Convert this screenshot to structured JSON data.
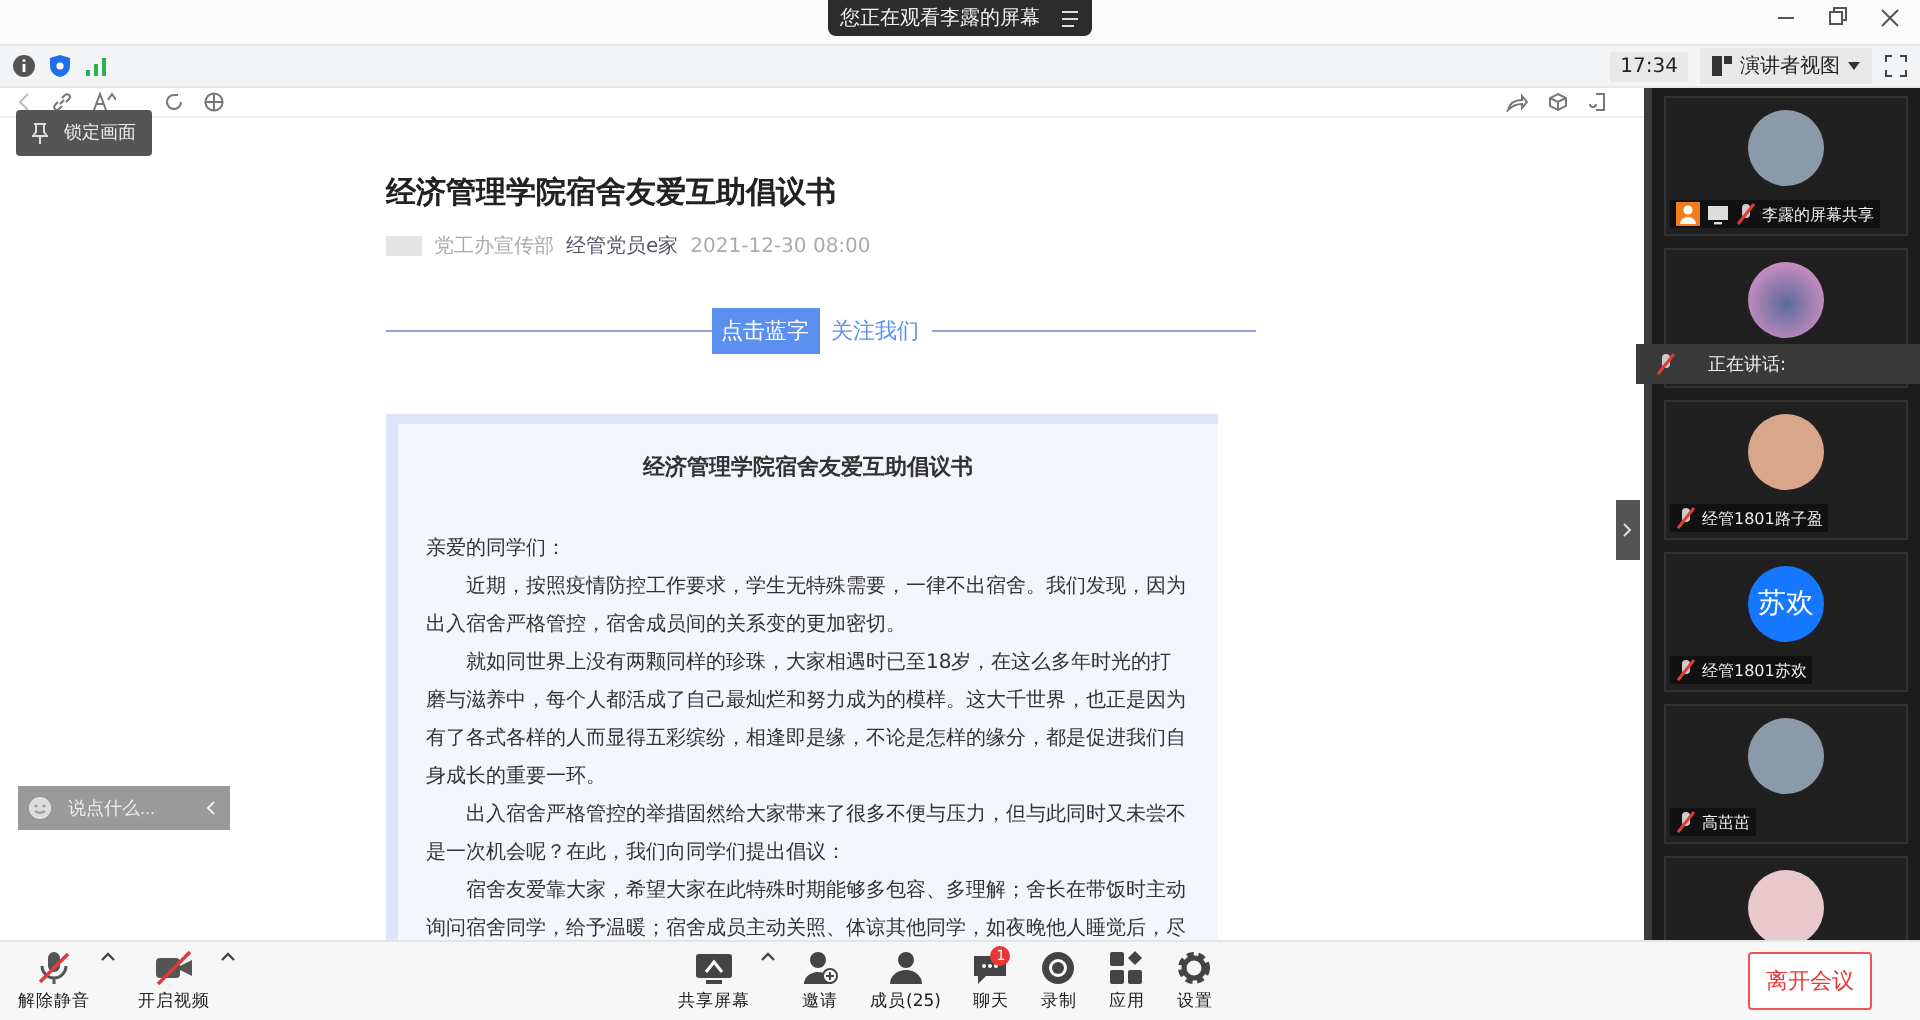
{
  "banner": {
    "text": "您正在观看李露的屏幕"
  },
  "status_bar": {
    "time": "17:34",
    "view_mode": "演讲者视图"
  },
  "pin_tooltip": {
    "label": "锁定画面"
  },
  "article": {
    "title": "经济管理学院宿舍友爱互助倡议书",
    "author": "党工办宣传部",
    "account": "经管党员e家",
    "date": "2021-12-30 08:00",
    "follow_button": "点击蓝字",
    "follow_text": "关注我们",
    "card_title": "经济管理学院宿舍友爱互助倡议书",
    "salutation": "亲爱的同学们：",
    "paragraphs": [
      "近期，按照疫情防控工作要求，学生无特殊需要，一律不出宿舍。我们发现，因为出入宿舍严格管控，宿舍成员间的关系变的更加密切。",
      "就如同世界上没有两颗同样的珍珠，大家相遇时已至18岁，在这么多年时光的打磨与滋养中，每个人都活成了自己最灿烂和努力成为的模样。这大千世界，也正是因为有了各式各样的人而显得五彩缤纷，相逢即是缘，不论是怎样的缘分，都是促进我们自身成长的重要一环。",
      "出入宿舍严格管控的举措固然给大家带来了很多不便与压力，但与此同时又未尝不是一次机会呢？在此，我们向同学们提出倡议：",
      "宿舍友爱靠大家，希望大家在此特殊时期能够多包容、多理解；舍长在带饭时主动询问宿舍同学，给予温暖；宿舍成员主动关照、体谅其他同学，如夜晚他人睡觉后，尽"
    ]
  },
  "chat_input": {
    "placeholder": "说点什么..."
  },
  "speaking": {
    "label": "正在讲话:"
  },
  "participants": [
    {
      "name": "李露的屏幕共享",
      "kind": "photo",
      "host": true,
      "sharing": true
    },
    {
      "kind": "cartoon"
    },
    {
      "name": "经管1801路子盈",
      "kind": "photo",
      "host": false,
      "sharing": false
    },
    {
      "name": "经管1801苏欢",
      "kind": "initials",
      "initials": "苏欢",
      "host": false,
      "sharing": false
    },
    {
      "name": "高茁茁",
      "kind": "photo",
      "host": false,
      "sharing": false
    },
    {
      "kind": "photo"
    }
  ],
  "toolbar": {
    "left": [
      {
        "label": "解除静音",
        "kind": "mic"
      },
      {
        "label": "开启视频",
        "kind": "video"
      }
    ],
    "center": [
      {
        "label": "共享屏幕",
        "kind": "share"
      },
      {
        "label": "邀请",
        "kind": "invite"
      },
      {
        "label": "成员(25)",
        "kind": "members"
      },
      {
        "label": "聊天",
        "kind": "chat",
        "badge": "1"
      },
      {
        "label": "录制",
        "kind": "record"
      },
      {
        "label": "应用",
        "kind": "apps"
      },
      {
        "label": "设置",
        "kind": "settings"
      }
    ],
    "leave": "离开会议"
  }
}
